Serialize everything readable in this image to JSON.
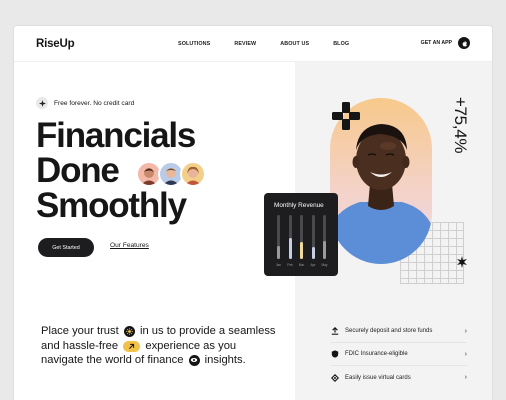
{
  "brand": {
    "name": "RiseUp"
  },
  "nav": {
    "links": [
      "SOLUTIONS",
      "REVIEW",
      "ABOUT US",
      "BLOG"
    ],
    "cta_label": "GET AN APP"
  },
  "hero": {
    "badge_text": "Free forever. No credit card",
    "headline": [
      "Financials",
      "Done",
      "Smoothly"
    ],
    "primary_button": "Get Started",
    "secondary_link": "Our Features"
  },
  "stats": {
    "growth": "+75,4%"
  },
  "revenue_card": {
    "title": "Monthly Revenue",
    "months": [
      "Jan",
      "Feb",
      "Mar",
      "Apr",
      "May"
    ],
    "levels": [
      0.55,
      0.85,
      0.7,
      0.5,
      0.75
    ],
    "colors": [
      "#9a9a9e",
      "#c6cfe3",
      "#f0d99a",
      "#c6cfe3",
      "#9a9a9e"
    ]
  },
  "bottom": {
    "parts": [
      "Place your trust",
      "in us to provide a seamless and hassle-free",
      "experience as you navigate the world of finance",
      "insights."
    ]
  },
  "features": [
    {
      "icon": "upload-icon",
      "label": "Securely deposit and store funds"
    },
    {
      "icon": "shield-icon",
      "label": "FDIC Insurance-eligible"
    },
    {
      "icon": "card-icon",
      "label": "Easily issue virtual cards"
    }
  ],
  "colors": {
    "accent_yellow": "#f1c14a",
    "dark": "#1d1d1f",
    "arch_top": "#f7c98b",
    "arch_bottom": "#e7dbea"
  }
}
